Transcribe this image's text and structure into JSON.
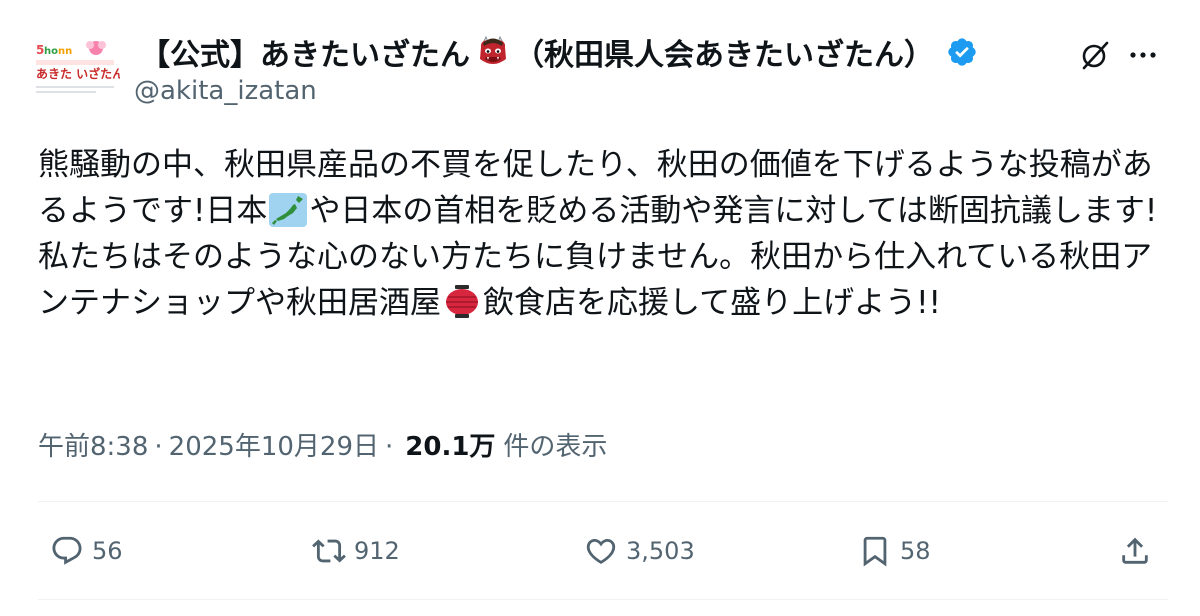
{
  "author": {
    "display_name": "【公式】あきたいざたん",
    "display_name_suffix": "（秋田県人会あきたいざたん）",
    "handle": "@akita_izatan",
    "avatar_text": "あきた いざたん",
    "verified_color": "#1d9bf0",
    "icons": {
      "oni": "ogre-emoji-icon",
      "verified": "verified-badge-icon"
    }
  },
  "toolbar": {
    "grok_icon": "grok-icon",
    "more_icon": "more-icon"
  },
  "tweet": {
    "text_part1": "熊騒動の中、秋田県産品の不買を促したり、秋田の価値を下げるような投稿があるようです!日本",
    "text_part2": "や日本の首相を貶める活動や発言に対しては断固抗議します!私たちはそのような心のない方たちに負けません。秋田から仕入れている秋田アンテナショップや秋田居酒屋",
    "text_part3": "飲食店を応援して盛り上げよう!!",
    "emojis": [
      "japan-map-emoji-icon",
      "red-lantern-emoji-icon"
    ]
  },
  "meta": {
    "time": "午前8:38",
    "separator": "·",
    "date": "2025年10月29日",
    "views_count": "20.1万",
    "views_label": "件の表示"
  },
  "actions": {
    "reply_count": "56",
    "retweet_count": "912",
    "like_count": "3,503",
    "bookmark_count": "58"
  },
  "colors": {
    "text": "#0f1419",
    "secondary": "#536471",
    "accent": "#1d9bf0",
    "divider": "#eff3f4"
  }
}
